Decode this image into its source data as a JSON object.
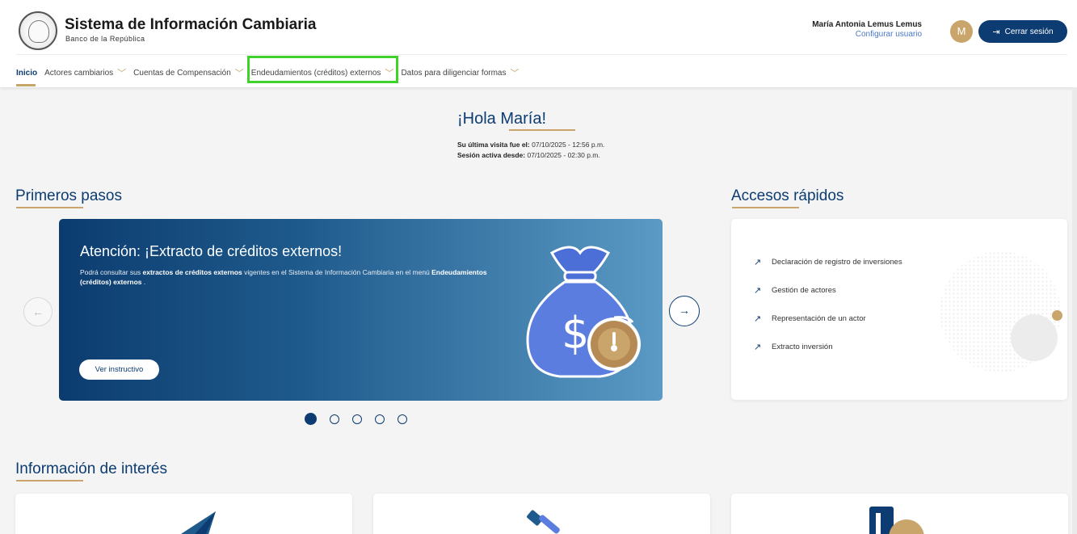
{
  "header": {
    "title": "Sistema de Información Cambiaria",
    "subtitle": "Banco de la República",
    "user_name": "María Antonia Lemus Lemus",
    "user_config": "Configurar usuario",
    "avatar_initial": "M",
    "logout_label": "Cerrar sesión"
  },
  "nav": {
    "items": [
      {
        "label": "Inicio"
      },
      {
        "label": "Actores cambiarios"
      },
      {
        "label": "Cuentas de Compensación"
      },
      {
        "label": "Endeudamientos (créditos) externos"
      },
      {
        "label": "Datos para diligenciar formas"
      }
    ]
  },
  "greeting": {
    "title": "¡Hola María!",
    "last_visit_label": "Su última visita fue el:",
    "last_visit_value": "07/10/2025 - 12:56 p.m.",
    "session_label": "Sesión activa desde:",
    "session_value": "07/10/2025 - 02:30 p.m."
  },
  "primeros_pasos": {
    "title": "Primeros pasos",
    "banner_title": "Atención: ¡Extracto de créditos externos!",
    "banner_text_1": "Podrá consultar sus ",
    "banner_text_bold_1": "extractos de créditos externos",
    "banner_text_2": " vigentes en el Sistema de Información Cambiaria en el menú ",
    "banner_text_bold_2": "Endeudamientos (créditos) externos",
    "banner_text_3": " .",
    "button_label": "Ver instructivo",
    "slide_count": 5,
    "active_slide": 1
  },
  "accesos": {
    "title": "Accesos rápidos",
    "items": [
      {
        "label": "Declaración de registro de inversiones"
      },
      {
        "label": "Gestión de actores"
      },
      {
        "label": "Representación de un actor"
      },
      {
        "label": "Extracto inversión"
      }
    ]
  },
  "info": {
    "title": "Información de interés"
  },
  "colors": {
    "primary": "#0d3c72",
    "accent_gold": "#c9a56b",
    "highlight": "#3fd22a"
  }
}
